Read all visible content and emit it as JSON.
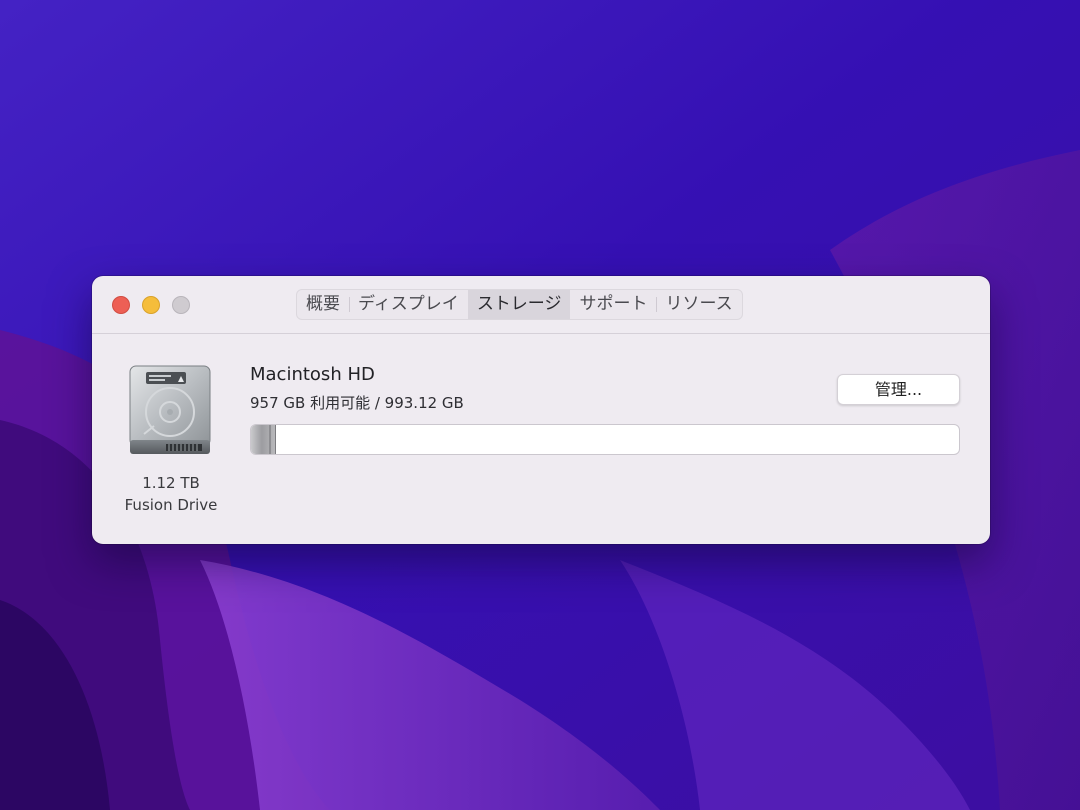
{
  "window": {
    "tabs": [
      {
        "label": "概要",
        "active": false
      },
      {
        "label": "ディスプレイ",
        "active": false
      },
      {
        "label": "ストレージ",
        "active": true
      },
      {
        "label": "サポート",
        "active": false
      },
      {
        "label": "リソース",
        "active": false
      }
    ]
  },
  "drive": {
    "icon": "hard-drive-icon",
    "capacity": "1.12 TB",
    "type": "Fusion Drive"
  },
  "volume": {
    "name": "Macintosh HD",
    "usage": "957 GB 利用可能 / 993.12 GB",
    "used_fraction": 0.036,
    "manage_label": "管理..."
  },
  "colors": {
    "close": "#ed5f55",
    "minimize": "#f5bd3b",
    "zoom": "#cfcbd0",
    "window_bg": "#efebf1"
  }
}
